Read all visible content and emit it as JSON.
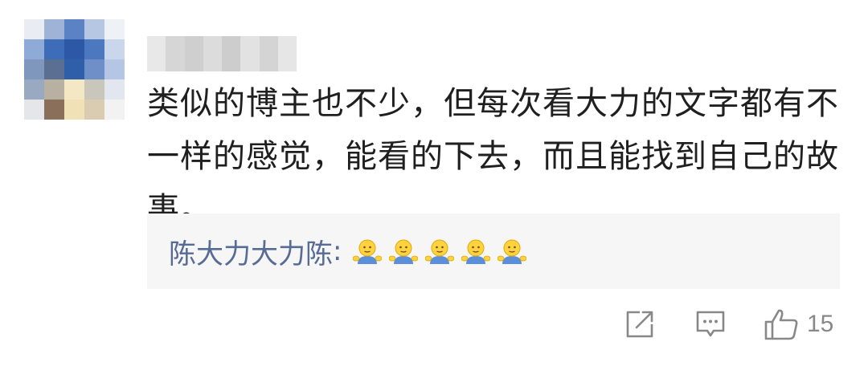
{
  "comment": {
    "text": "类似的博主也不少，但每次看大力的文字都有不一样的感觉，能看的下去，而且能找到自己的故事。"
  },
  "reply": {
    "author": "陈大力大力陈",
    "separator": ":",
    "emojis": [
      "shrug-emoji",
      "shrug-emoji",
      "shrug-emoji",
      "shrug-emoji",
      "shrug-emoji"
    ]
  },
  "actions": {
    "like_count": "15"
  },
  "colors": {
    "reply_author": "#576b95",
    "reply_background": "#f6f6f6",
    "icon_gray": "#888888",
    "text": "#1f1f1f"
  },
  "icons": [
    "share-icon",
    "comment-icon",
    "thumbs-up-icon"
  ]
}
